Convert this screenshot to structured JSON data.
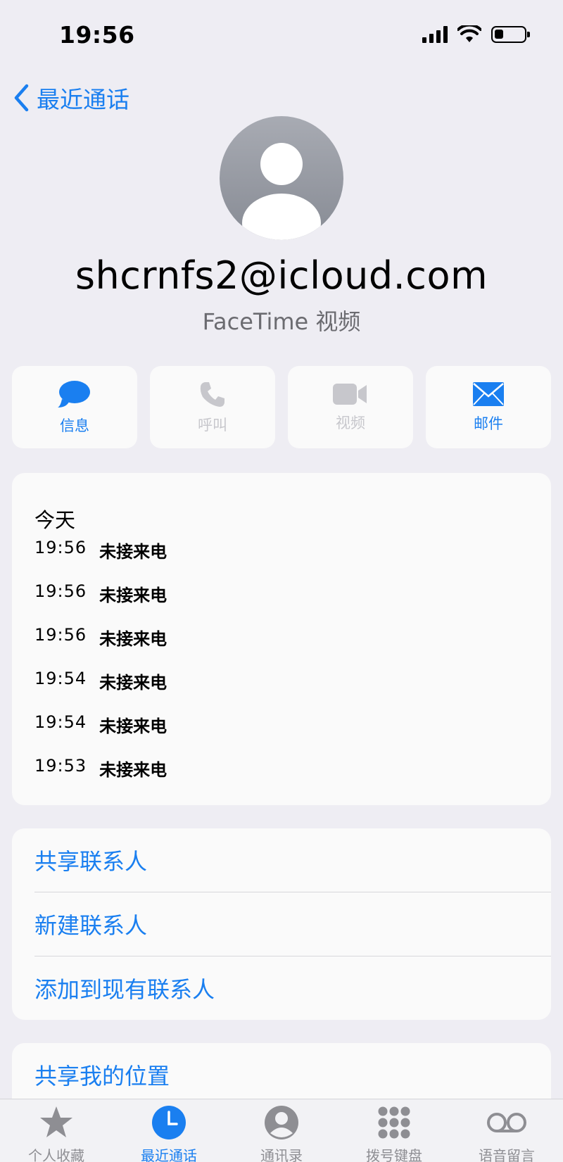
{
  "status_bar": {
    "time": "19:56"
  },
  "nav": {
    "back_label": "最近通话"
  },
  "contact": {
    "name": "shcrnfs2@icloud.com",
    "subtitle": "FaceTime 视频"
  },
  "actions": [
    {
      "label": "信息",
      "icon": "message-bubble-icon",
      "enabled": true
    },
    {
      "label": "呼叫",
      "icon": "phone-icon",
      "enabled": false
    },
    {
      "label": "视频",
      "icon": "video-camera-icon",
      "enabled": false
    },
    {
      "label": "邮件",
      "icon": "envelope-icon",
      "enabled": true
    }
  ],
  "recents": {
    "heading": "今天",
    "calls": [
      {
        "time": "19:56",
        "type": "未接来电"
      },
      {
        "time": "19:56",
        "type": "未接来电"
      },
      {
        "time": "19:56",
        "type": "未接来电"
      },
      {
        "time": "19:54",
        "type": "未接来电"
      },
      {
        "time": "19:54",
        "type": "未接来电"
      },
      {
        "time": "19:53",
        "type": "未接来电"
      }
    ]
  },
  "contact_actions": [
    {
      "label": "共享联系人"
    },
    {
      "label": "新建联系人"
    },
    {
      "label": "添加到现有联系人"
    }
  ],
  "location": {
    "label": "共享我的位置"
  },
  "tabs": [
    {
      "label": "个人收藏",
      "icon": "star-icon",
      "active": false
    },
    {
      "label": "最近通话",
      "icon": "clock-icon",
      "active": true
    },
    {
      "label": "通讯录",
      "icon": "person-circle-icon",
      "active": false
    },
    {
      "label": "拨号键盘",
      "icon": "keypad-icon",
      "active": false
    },
    {
      "label": "语音留言",
      "icon": "voicemail-icon",
      "active": false
    }
  ],
  "colors": {
    "accent": "#1a7ff0",
    "background": "#eeedf3",
    "card": "#fafafa",
    "disabled": "#c7c7cc"
  },
  "battery_level": 0.3
}
